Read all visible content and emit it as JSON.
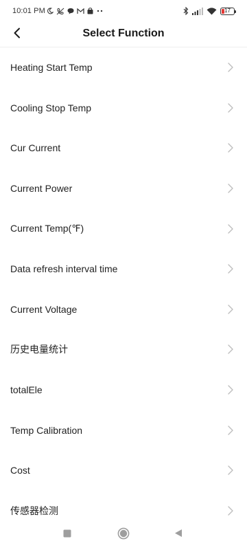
{
  "status_bar": {
    "time": "10:01 PM",
    "left_icons": [
      "moon-icon",
      "call-muted-icon",
      "chat-icon",
      "mail-icon",
      "bag-icon",
      "more-dots-icon"
    ],
    "right_icons": [
      "bluetooth-icon",
      "signal-icon",
      "wifi-icon",
      "battery-icon"
    ],
    "battery_level": "17",
    "battery_color": "#e53935"
  },
  "header": {
    "back_icon": "chevron-left-icon",
    "title": "Select Function"
  },
  "functions": [
    {
      "label": "Heating Start Temp"
    },
    {
      "label": "Cooling Stop Temp"
    },
    {
      "label": "Cur Current"
    },
    {
      "label": "Current Power"
    },
    {
      "label": "Current Temp(℉)"
    },
    {
      "label": "Data refresh interval time"
    },
    {
      "label": "Current Voltage"
    },
    {
      "label": "历史电量统计"
    },
    {
      "label": "totalEle"
    },
    {
      "label": "Temp Calibration"
    },
    {
      "label": "Cost"
    },
    {
      "label": "传感器检测"
    }
  ],
  "nav_bar": {
    "buttons": [
      "recent-apps-icon",
      "home-icon",
      "back-triangle-icon"
    ]
  }
}
